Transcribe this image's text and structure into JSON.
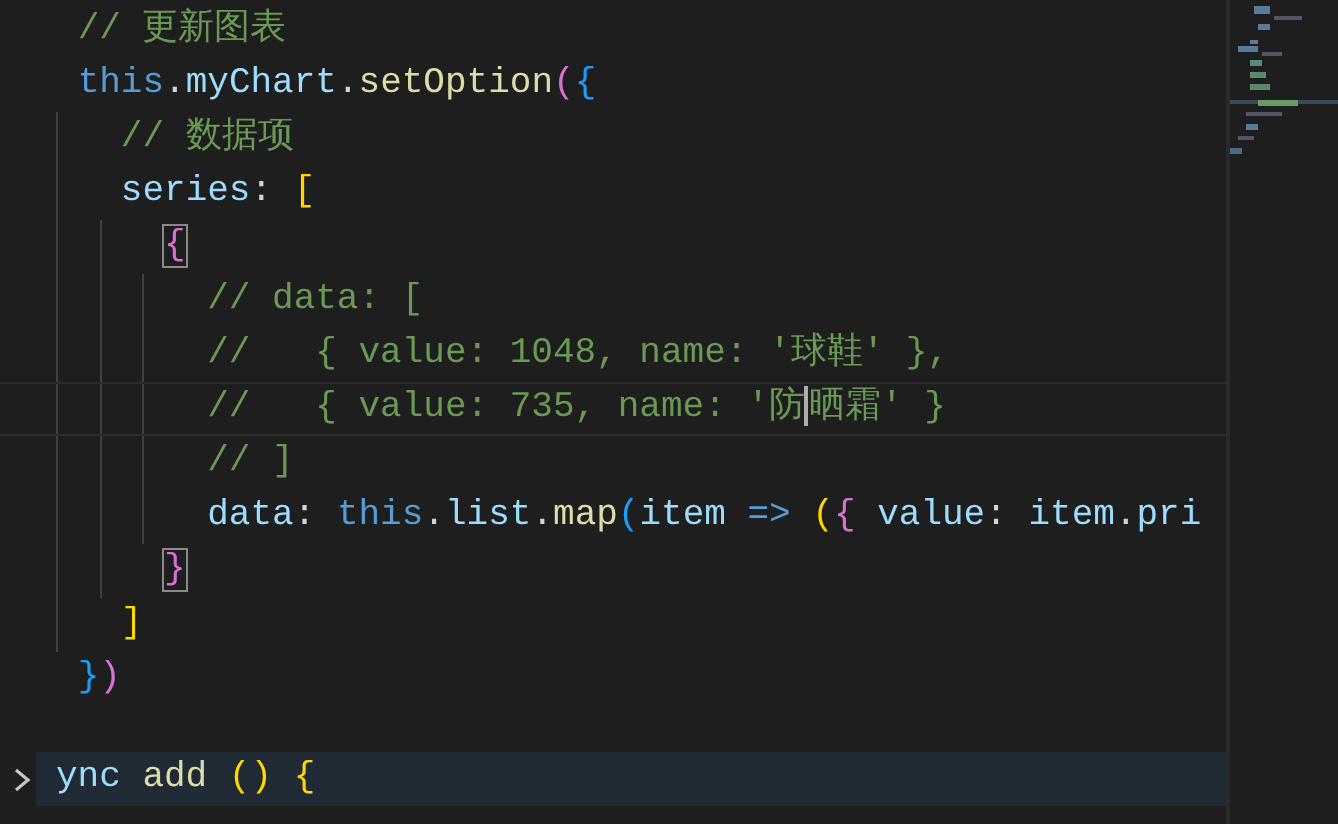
{
  "editor": {
    "lines": [
      {
        "current": false,
        "tokens": [
          {
            "kind": "comment",
            "text": "// 更新图表"
          }
        ]
      },
      {
        "current": false,
        "tokens": [
          {
            "kind": "keyword",
            "text": "this"
          },
          {
            "kind": "plain",
            "text": "."
          },
          {
            "kind": "property",
            "text": "myChart"
          },
          {
            "kind": "plain",
            "text": "."
          },
          {
            "kind": "method",
            "text": "setOption"
          },
          {
            "kind": "bracket-pink",
            "text": "("
          },
          {
            "kind": "bracket-blue",
            "text": "{"
          }
        ]
      },
      {
        "current": false,
        "tokens": [
          {
            "kind": "comment",
            "text": "  // 数据项"
          }
        ]
      },
      {
        "current": false,
        "tokens": [
          {
            "kind": "property",
            "text": "  series"
          },
          {
            "kind": "plain",
            "text": ": "
          },
          {
            "kind": "bracket-gold",
            "text": "["
          }
        ]
      },
      {
        "current": false,
        "tokens": [
          {
            "kind": "bracket-pink-matched",
            "text": "    {"
          }
        ]
      },
      {
        "current": false,
        "tokens": [
          {
            "kind": "comment",
            "text": "      // data: ["
          }
        ]
      },
      {
        "current": false,
        "tokens": [
          {
            "kind": "comment",
            "text": "      //   { value: 1048, name: '球鞋' },"
          }
        ]
      },
      {
        "current": true,
        "tokens": [
          {
            "kind": "comment",
            "text": "      //   { value: 735, name: '防"
          },
          {
            "kind": "caret"
          },
          {
            "kind": "comment",
            "text": "晒霜' }"
          }
        ]
      },
      {
        "current": false,
        "tokens": [
          {
            "kind": "comment",
            "text": "      // ]"
          }
        ]
      },
      {
        "current": false,
        "tokens": [
          {
            "kind": "property",
            "text": "      data"
          },
          {
            "kind": "plain",
            "text": ": "
          },
          {
            "kind": "keyword",
            "text": "this"
          },
          {
            "kind": "plain",
            "text": "."
          },
          {
            "kind": "property",
            "text": "list"
          },
          {
            "kind": "plain",
            "text": "."
          },
          {
            "kind": "method",
            "text": "map"
          },
          {
            "kind": "bracket-blue",
            "text": "("
          },
          {
            "kind": "property",
            "text": "item"
          },
          {
            "kind": "keyword",
            "text": " => "
          },
          {
            "kind": "bracket-gold",
            "text": "("
          },
          {
            "kind": "bracket-pink",
            "text": "{"
          },
          {
            "kind": "property",
            "text": " value"
          },
          {
            "kind": "plain",
            "text": ": "
          },
          {
            "kind": "property",
            "text": "item"
          },
          {
            "kind": "plain",
            "text": "."
          },
          {
            "kind": "property",
            "text": "pri"
          }
        ]
      },
      {
        "current": false,
        "tokens": [
          {
            "kind": "bracket-pink-matched",
            "text": "    }"
          }
        ]
      },
      {
        "current": false,
        "tokens": [
          {
            "kind": "bracket-gold",
            "text": "  ]"
          }
        ]
      },
      {
        "current": false,
        "tokens": [
          {
            "kind": "bracket-blue",
            "text": "}"
          },
          {
            "kind": "bracket-pink",
            "text": ")"
          }
        ]
      }
    ],
    "next_line": {
      "selected": true,
      "folded": true,
      "tokens": [
        {
          "kind": "property",
          "text": "ync"
        },
        {
          "kind": "method",
          "text": " add "
        },
        {
          "kind": "bracket-gold",
          "text": "()"
        },
        {
          "kind": "bracket-gold",
          "text": " {"
        }
      ]
    }
  }
}
